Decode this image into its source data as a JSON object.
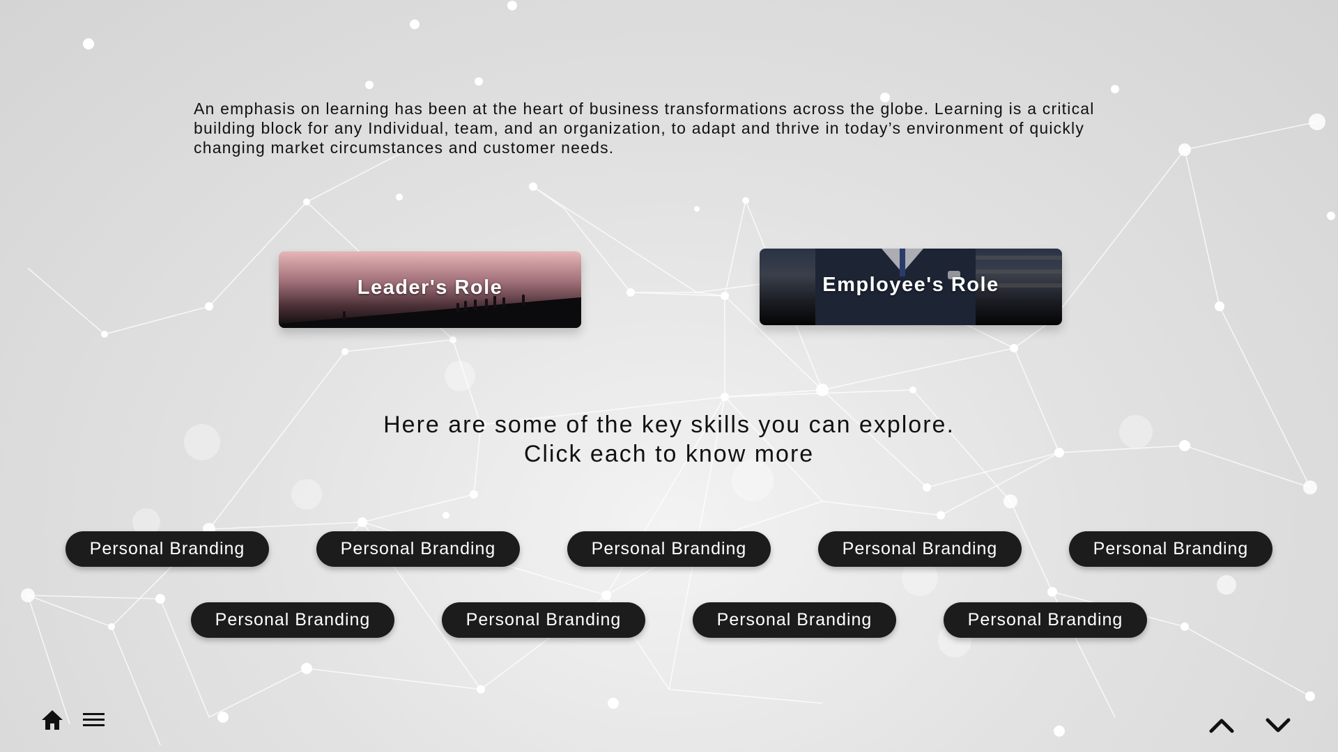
{
  "intro": {
    "text": "An emphasis on learning has been at the heart of business transformations across the globe. Learning is a critical building block for any Individual, team, and an organization, to adapt and thrive in today’s environment of quickly changing market circumstances and customer needs."
  },
  "roles": {
    "leader_label": "Leader's Role",
    "employee_label": "Employee's Role"
  },
  "prompt": {
    "line1": "Here are some of the key skills you can explore.",
    "line2": "Click each to know more"
  },
  "skills": {
    "row1": [
      "Personal Branding",
      "Personal Branding",
      "Personal Branding",
      "Personal Branding",
      "Personal Branding"
    ],
    "row2": [
      "Personal Branding",
      "Personal Branding",
      "Personal Branding",
      "Personal Branding"
    ]
  },
  "nav": {
    "home_icon": "home-icon",
    "menu_icon": "hamburger-menu-icon",
    "prev_icon": "chevron-up-icon",
    "next_icon": "chevron-down-icon"
  },
  "colors": {
    "pill_bg": "#1c1c1c",
    "pill_text": "#ffffff",
    "background": "#e2e2e2"
  }
}
